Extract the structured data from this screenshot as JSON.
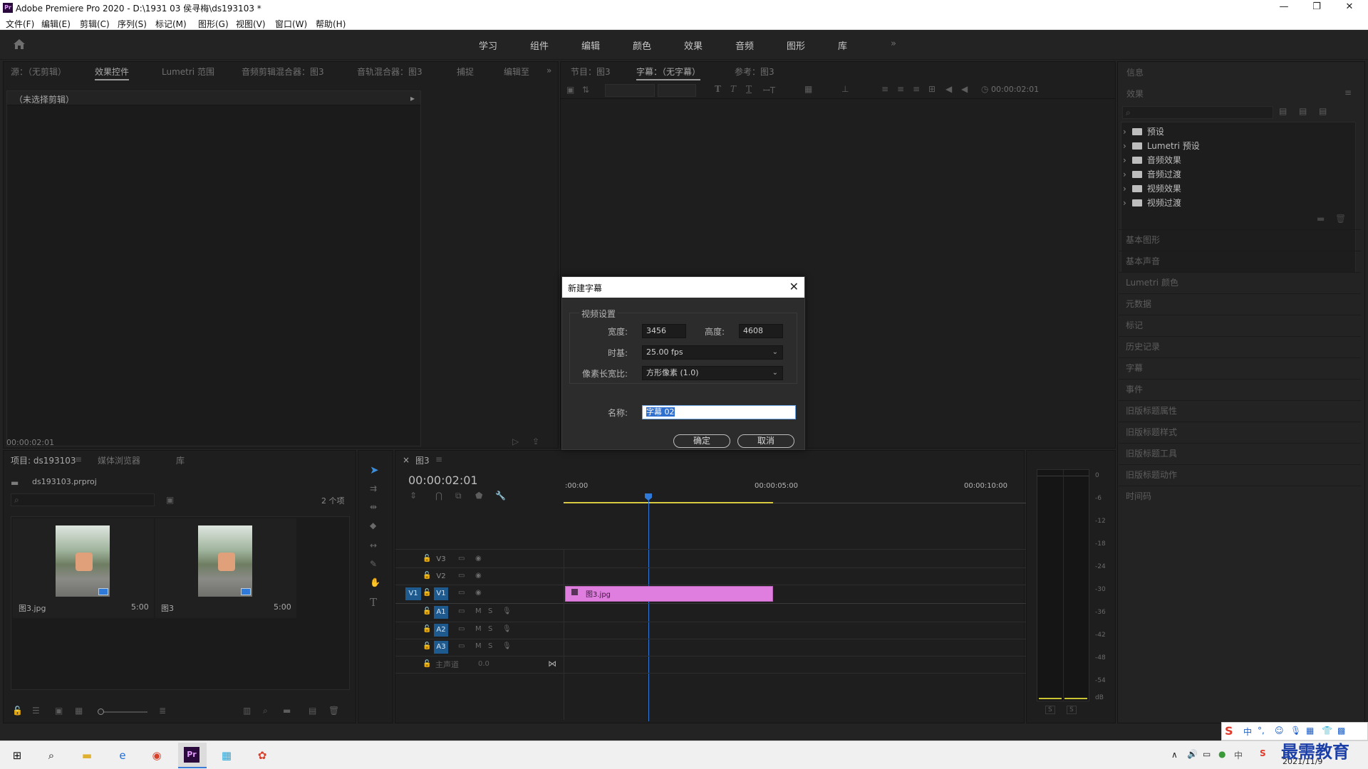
{
  "app": {
    "logo": "Pr",
    "title": "Adobe Premiere Pro 2020 - D:\\1931 03 侯寻梅\\ds193103 *",
    "window_controls": [
      "—",
      "❐",
      "✕"
    ]
  },
  "menu": [
    "文件(F)",
    "编辑(E)",
    "剪辑(C)",
    "序列(S)",
    "标记(M)",
    "图形(G)",
    "视图(V)",
    "窗口(W)",
    "帮助(H)"
  ],
  "workspaces": [
    "学习",
    "组件",
    "编辑",
    "颜色",
    "效果",
    "音频",
    "图形",
    "库"
  ],
  "workspaces_more": "»",
  "source_panel": {
    "tabs": [
      "源：（无剪辑）",
      "效果控件",
      "Lumetri 范围",
      "音频剪辑混合器：图3",
      "音轨混合器：图3",
      "捕捉",
      "编辑至"
    ],
    "more": "»",
    "no_clip": "（未选择剪辑）",
    "expand": "▸",
    "timecode": "00:00:02:01"
  },
  "program_panel": {
    "tabs": [
      "节目：图3",
      "字幕：（无字幕）",
      "参考：图3"
    ],
    "timecode": "00:00:02:01"
  },
  "dialog": {
    "title": "新建字幕",
    "close": "✕",
    "group_label": "视频设置",
    "width_label": "宽度:",
    "width_value": "3456",
    "height_label": "高度:",
    "height_value": "4608",
    "timebase_label": "时基:",
    "timebase_value": "25.00 fps",
    "par_label": "像素长宽比:",
    "par_value": "方形像素 (1.0)",
    "name_label": "名称:",
    "name_value": "字幕 02",
    "ok": "确定",
    "cancel": "取消"
  },
  "project_panel": {
    "tabs": [
      "项目: ds193103",
      "媒体浏览器",
      "库"
    ],
    "project_file": "ds193103.prproj",
    "item_count": "2 个项",
    "items": [
      {
        "name": "图3.jpg",
        "duration": "5:00"
      },
      {
        "name": "图3",
        "duration": "5:00"
      }
    ]
  },
  "timeline": {
    "close": "×",
    "tab": "图3",
    "timecode": "00:00:02:01",
    "ruler": [
      ":00:00",
      "00:00:05:00",
      "00:00:10:00"
    ],
    "video_tracks": [
      "V3",
      "V2",
      "V1"
    ],
    "audio_tracks": [
      "A1",
      "A2",
      "A3"
    ],
    "master": "主声道",
    "master_value": "0.0",
    "source_patch": "V1",
    "clip_name": "图3.jpg",
    "track_toggles": [
      "M",
      "S"
    ]
  },
  "meter": {
    "scale": [
      "0",
      "-6",
      "-12",
      "-18",
      "-24",
      "-30",
      "-36",
      "-42",
      "-48",
      "-54",
      "dB"
    ],
    "solo": [
      "S",
      "S"
    ]
  },
  "right_panels": {
    "info": "信息",
    "effects": "效果",
    "effects_folders": [
      "预设",
      "Lumetri 预设",
      "音频效果",
      "音频过渡",
      "视频效果",
      "视频过渡"
    ],
    "other": [
      "基本图形",
      "基本声音",
      "Lumetri 颜色",
      "元数据",
      "标记",
      "历史记录",
      "字幕",
      "事件",
      "旧版标题属性",
      "旧版标题样式",
      "旧版标题工具",
      "旧版标题动作",
      "时间码"
    ]
  },
  "taskbar": {
    "clock": "2021/11/9",
    "ime": "中",
    "tray": "∧",
    "watermark": "最需教育"
  },
  "colors": {
    "clip": "#e07ee0",
    "playhead": "#2f7ad8",
    "track_on": "#1f5a8e"
  }
}
